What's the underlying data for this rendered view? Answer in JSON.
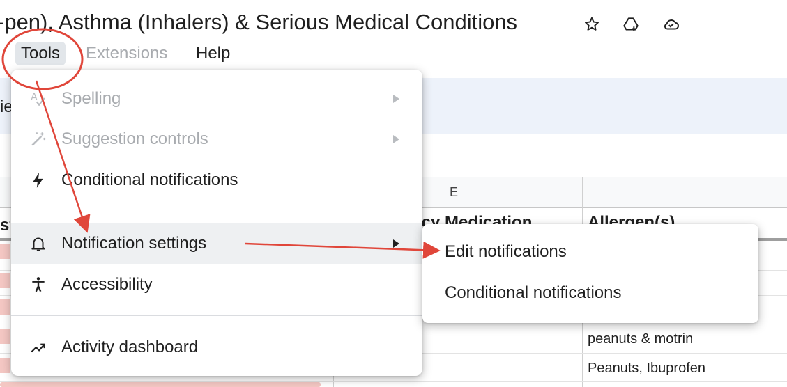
{
  "document": {
    "title": "-pen), Asthma (Inhalers) & Serious Medical Conditions"
  },
  "title_icons": [
    "star-icon",
    "move-to-drive-icon",
    "cloud-saved-icon"
  ],
  "menubar": {
    "tools": "Tools",
    "extensions": "Extensions",
    "help": "Help"
  },
  "sheet": {
    "column_e_label": "E",
    "header_medication_partial": "ncy Medication",
    "header_allergens_partial": "Allergen(s)",
    "left_header_partial": "st",
    "left_partial": "ie",
    "rows": [
      {
        "allergens": "peanuts & motrin"
      },
      {
        "allergens": "Peanuts, Ibuprofen"
      }
    ]
  },
  "tools_menu": {
    "items": [
      {
        "label": "Spelling",
        "icon": "spellcheck-icon",
        "disabled": true,
        "submenu": true
      },
      {
        "label": "Suggestion controls",
        "icon": "magic-wand-icon",
        "disabled": true,
        "submenu": true
      },
      {
        "label": "Conditional notifications",
        "icon": "lightning-bolt-icon",
        "disabled": false,
        "submenu": false
      },
      {
        "label": "Notification settings",
        "icon": "bell-icon",
        "disabled": false,
        "submenu": true
      },
      {
        "label": "Accessibility",
        "icon": "accessibility-icon",
        "disabled": false,
        "submenu": false
      },
      {
        "label": "Activity dashboard",
        "icon": "trending-up-icon",
        "disabled": false,
        "submenu": false
      }
    ]
  },
  "notification_submenu": {
    "items": [
      {
        "label": "Edit notifications"
      },
      {
        "label": "Conditional notifications"
      }
    ]
  },
  "colors": {
    "annotation_red": "#e0463a",
    "menu_hover": "#eef0f2",
    "disabled_text": "#a8abaf",
    "toolbar_band": "#edf2fa"
  }
}
